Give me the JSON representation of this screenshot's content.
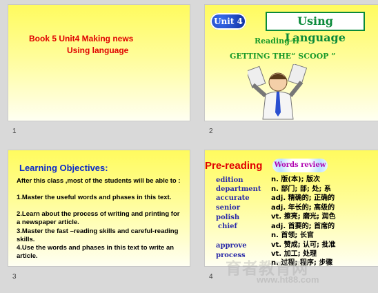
{
  "slides": [
    {
      "number": "1",
      "title_line1": "Book 5    Unit4 Making news",
      "title_line2": "Using     language"
    },
    {
      "number": "2",
      "badge": "Unit 4",
      "title": "Using Language",
      "subtitle": "Reading  II",
      "heading": "GETTING THE“ SCOOP ”",
      "star_icon": "★"
    },
    {
      "number": "3",
      "title": "Learning Objectives:",
      "intro": "After this class ,most of the students will be able to :",
      "items": [
        "1.Master the useful words and phases in this text.",
        "2.Learn about the process of  writing and printing for a newspaper article.",
        "3.Master the fast –reading  skills and careful-reading skills.",
        "4.Use the words and phases in this text to write an article."
      ]
    },
    {
      "number": "4",
      "title": "Pre-reading",
      "label": "Words review",
      "words_en": [
        "edition",
        "department",
        "accurate",
        "senior",
        "polish",
        " chief",
        "",
        "approve",
        "process"
      ],
      "words_cn": [
        "n. 版(本); 版次",
        "n. 部门; 部; 处; 系",
        "adj. 精确的; 正确的",
        "adj. 年长的; 高级的",
        "vt. 擦亮; 磨光; 润色",
        "adj. 首要的; 首席的",
        "n. 首领; 长官",
        "vt. 赞成; 认可; 批准",
        "vt. 加工; 处理",
        "n. 过程; 程序; 步骤"
      ]
    }
  ],
  "watermark": {
    "line1": "育者教育网",
    "line2": "www.ht88.com"
  }
}
